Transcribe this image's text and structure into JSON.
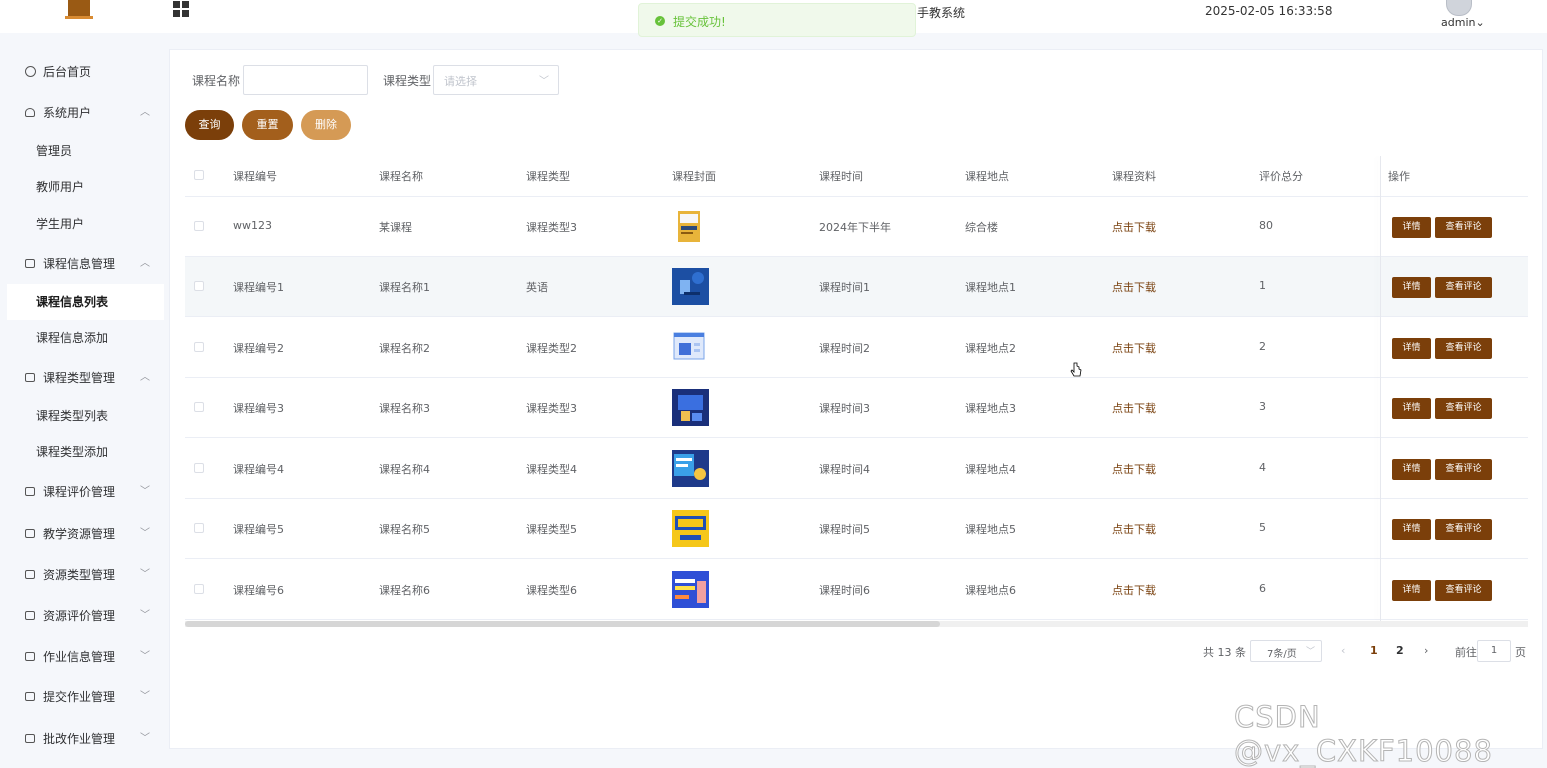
{
  "header": {
    "system_title": "手教系统",
    "datetime": "2025-02-05 16:33:58",
    "user": "admin",
    "user_arrow": "⌄",
    "toast": "提交成功!"
  },
  "sidebar": {
    "arrow_up": "︿",
    "arrow_down": "﹀",
    "items": [
      {
        "label": "后台首页"
      },
      {
        "label": "系统用户",
        "children": [
          "管理员",
          "教师用户",
          "学生用户"
        ]
      },
      {
        "label": "课程信息管理",
        "children": [
          "课程信息列表",
          "课程信息添加"
        ],
        "active_child": "课程信息列表"
      },
      {
        "label": "课程类型管理",
        "children": [
          "课程类型列表",
          "课程类型添加"
        ]
      },
      {
        "label": "课程评价管理"
      },
      {
        "label": "教学资源管理"
      },
      {
        "label": "资源类型管理"
      },
      {
        "label": "资源评价管理"
      },
      {
        "label": "作业信息管理"
      },
      {
        "label": "提交作业管理"
      },
      {
        "label": "批改作业管理"
      }
    ]
  },
  "filters": {
    "name_label": "课程名称",
    "name_value": "",
    "type_label": "课程类型",
    "type_placeholder": "请选择"
  },
  "buttons": {
    "query": "查询",
    "reset": "重置",
    "delete": "删除"
  },
  "table": {
    "columns": [
      "课程编号",
      "课程名称",
      "课程类型",
      "课程封面",
      "课程时间",
      "课程地点",
      "课程资料",
      "评价总分",
      "操作"
    ],
    "rows": [
      {
        "code": "ww123",
        "name": "某课程",
        "type": "课程类型3",
        "time": "2024年下半年",
        "place": "综合楼",
        "file": "点击下载",
        "score": "80"
      },
      {
        "code": "课程编号1",
        "name": "课程名称1",
        "type": "英语",
        "time": "课程时间1",
        "place": "课程地点1",
        "file": "点击下载",
        "score": "1"
      },
      {
        "code": "课程编号2",
        "name": "课程名称2",
        "type": "课程类型2",
        "time": "课程时间2",
        "place": "课程地点2",
        "file": "点击下载",
        "score": "2"
      },
      {
        "code": "课程编号3",
        "name": "课程名称3",
        "type": "课程类型3",
        "time": "课程时间3",
        "place": "课程地点3",
        "file": "点击下载",
        "score": "3"
      },
      {
        "code": "课程编号4",
        "name": "课程名称4",
        "type": "课程类型4",
        "time": "课程时间4",
        "place": "课程地点4",
        "file": "点击下载",
        "score": "4"
      },
      {
        "code": "课程编号5",
        "name": "课程名称5",
        "type": "课程类型5",
        "time": "课程时间5",
        "place": "课程地点5",
        "file": "点击下载",
        "score": "5"
      },
      {
        "code": "课程编号6",
        "name": "课程名称6",
        "type": "课程类型6",
        "time": "课程时间6",
        "place": "课程地点6",
        "file": "点击下载",
        "score": "6"
      }
    ],
    "action_detail": "详情",
    "action_comments": "查看评论"
  },
  "pagination": {
    "total": "共 13 条",
    "page_size": "7条/页",
    "prev": "‹",
    "pages": [
      "1",
      "2"
    ],
    "next": "›",
    "goto_prefix": "前往",
    "goto_value": "1",
    "goto_suffix": "页"
  },
  "watermark": "CSDN @vx_CXKF10088",
  "colors": {
    "accent": "#7b3f0a",
    "reset": "#a35f1c",
    "delete": "#d59a55",
    "success": "#67c23a"
  }
}
